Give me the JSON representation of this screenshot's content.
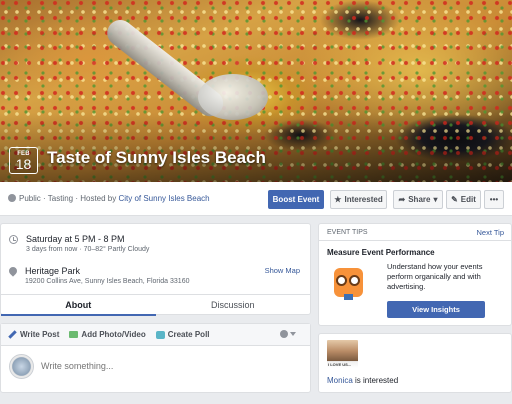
{
  "cover": {
    "month": "FEB",
    "day": "18",
    "title": "Taste of Sunny Isles Beach"
  },
  "info": {
    "meta_prefix": "Public · Tasting · Hosted by ",
    "host": "City of Sunny Isles Beach"
  },
  "actions": {
    "boost": "Boost Event",
    "interested": "Interested",
    "share": "Share",
    "edit": "Edit",
    "more": "•••"
  },
  "details": {
    "datetime": "Saturday at 5 PM - 8 PM",
    "weather": "3 days from now · 70–82° Partly Cloudy",
    "venue": "Heritage Park",
    "address": "19200 Collins Ave, Sunny Isles Beach, Florida 33160",
    "show_map": "Show Map"
  },
  "tabs": {
    "about": "About",
    "discussion": "Discussion"
  },
  "composer": {
    "write_post": "Write Post",
    "add_photo": "Add Photo/Video",
    "create_poll": "Create Poll",
    "placeholder": "Write something..."
  },
  "tips": {
    "label": "EVENT TIPS",
    "next": "Next Tip",
    "title": "Measure Event Performance",
    "text": "Understand how your events perform organically and with advertising.",
    "button": "View Insights"
  },
  "friends": {
    "photo_caption": "I LOVE US...",
    "name": "Monica",
    "status": " is interested"
  },
  "colors": {
    "brand_blue": "#4267b2",
    "link_blue": "#365899",
    "background": "#e9ebee"
  }
}
